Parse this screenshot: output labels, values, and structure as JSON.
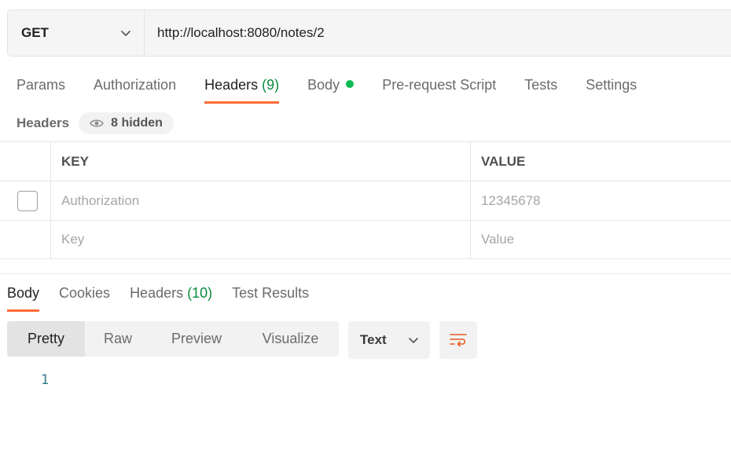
{
  "request": {
    "method": "GET",
    "url": "http://localhost:8080/notes/2"
  },
  "request_tabs": {
    "params": "Params",
    "authorization": "Authorization",
    "headers_label": "Headers",
    "headers_count": "(9)",
    "body": "Body",
    "pre_request": "Pre-request Script",
    "tests": "Tests",
    "settings": "Settings"
  },
  "headers_section": {
    "title": "Headers",
    "hidden_label": "8 hidden"
  },
  "headers_table": {
    "key_header": "KEY",
    "value_header": "VALUE",
    "rows": [
      {
        "key": "Authorization",
        "value": "12345678",
        "checked": false
      }
    ],
    "placeholder_key": "Key",
    "placeholder_value": "Value"
  },
  "response_tabs": {
    "body": "Body",
    "cookies": "Cookies",
    "headers_label": "Headers",
    "headers_count": "(10)",
    "test_results": "Test Results"
  },
  "response_toolbar": {
    "views": [
      "Pretty",
      "Raw",
      "Preview",
      "Visualize"
    ],
    "active_view": "Pretty",
    "format": "Text"
  },
  "response_body": {
    "line_numbers": [
      "1"
    ]
  },
  "colors": {
    "accent": "#ff6c37",
    "success": "#0cbb52",
    "count_green": "#0a8a3c"
  },
  "icons": [
    "chevron-down-icon",
    "eye-icon",
    "wrap-lines-icon"
  ]
}
